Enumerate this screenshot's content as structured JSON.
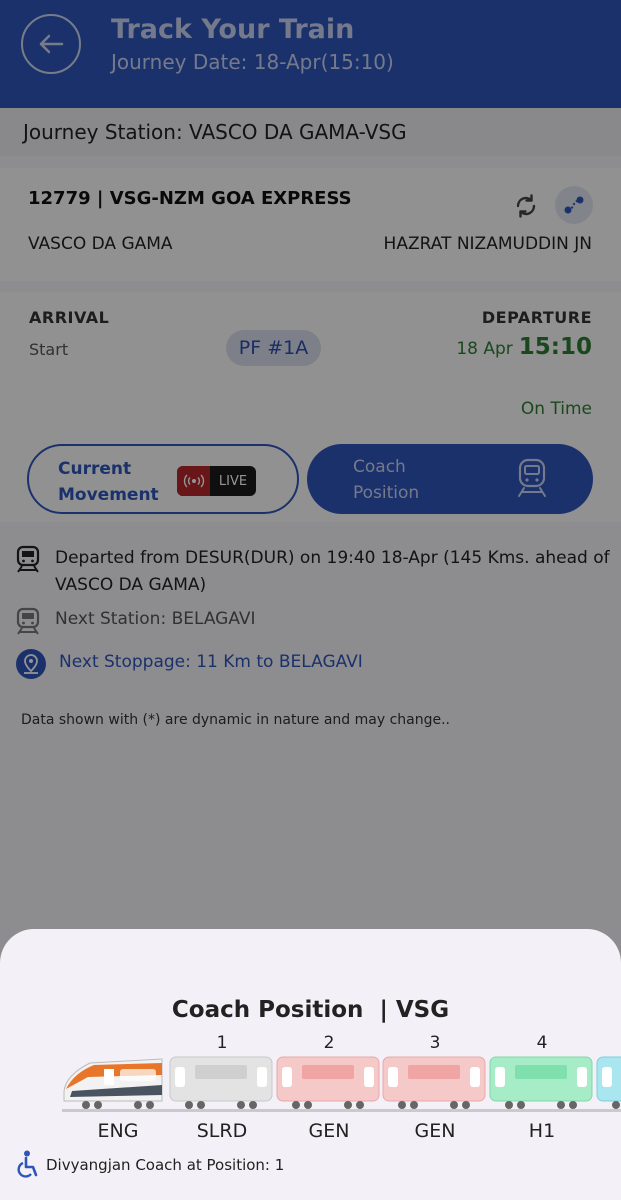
{
  "header": {
    "title": "Track Your Train",
    "subtitle": "Journey Date: 18-Apr(15:10)"
  },
  "journey_station": "Journey Station: VASCO DA GAMA-VSG",
  "train": {
    "number_name": "12779 | VSG-NZM GOA EXPRESS",
    "from": "VASCO DA GAMA",
    "to": "HAZRAT NIZAMUDDIN JN"
  },
  "timing": {
    "arrival_label": "ARRIVAL",
    "arrival_value": "Start",
    "platform": "PF #1A",
    "departure_label": "DEPARTURE",
    "departure_date": "18 Apr",
    "departure_time": "15:10",
    "status": "On Time"
  },
  "buttons": {
    "current_movement": "Current Movement",
    "live": "LIVE",
    "coach_position": "Coach Position"
  },
  "status_rows": {
    "departed": "Departed from DESUR(DUR) on 19:40 18-Apr (145 Kms. ahead of VASCO DA GAMA)",
    "next_station": "Next Station: BELAGAVI",
    "next_stoppage": "Next Stoppage: 11 Km to BELAGAVI"
  },
  "note": "Data shown with (*) are dynamic in nature and may change..",
  "sheet": {
    "title": "Coach Position",
    "station": "| VSG",
    "coaches": [
      {
        "label": "ENG",
        "position": "",
        "color": "#e8762a"
      },
      {
        "label": "SLRD",
        "position": "1",
        "color": "#e3e3e3"
      },
      {
        "label": "GEN",
        "position": "2",
        "color": "#f6b9b9"
      },
      {
        "label": "GEN",
        "position": "3",
        "color": "#f6b9b9"
      },
      {
        "label": "H1",
        "position": "4",
        "color": "#8fe3b7"
      }
    ],
    "divyangjan": "Divyangjan Coach at Position: 1"
  }
}
